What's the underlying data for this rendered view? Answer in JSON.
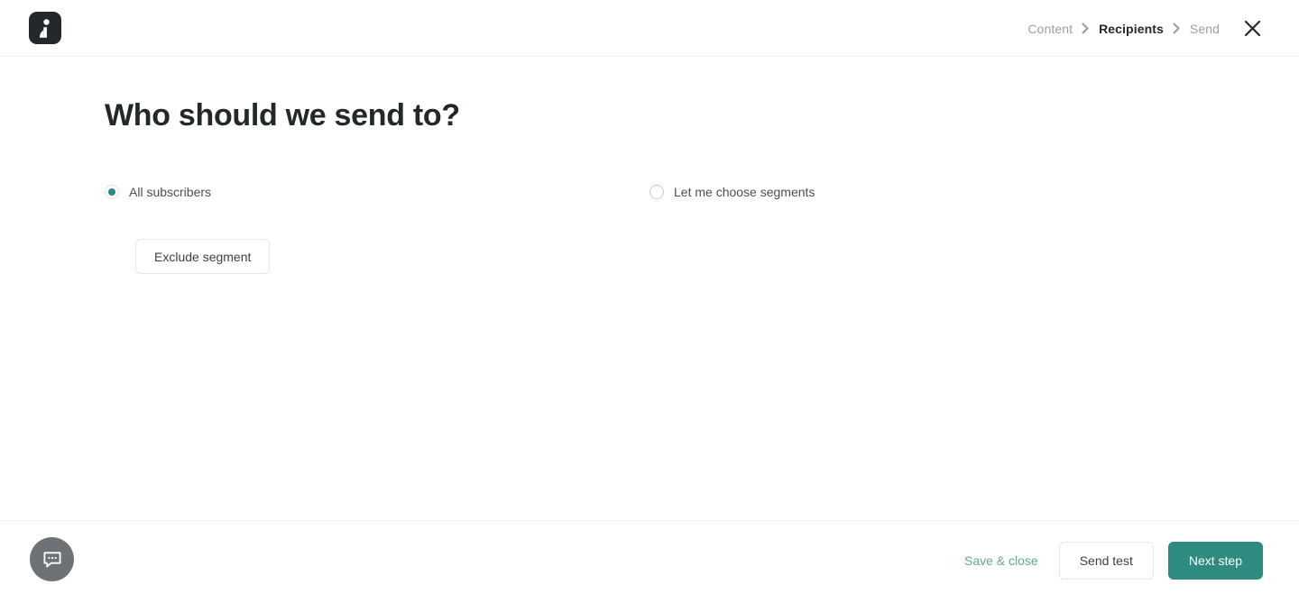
{
  "header": {
    "logo_name": "mailerlite-logo",
    "breadcrumb": [
      {
        "label": "Content",
        "state": "inactive"
      },
      {
        "label": "Recipients",
        "state": "active"
      },
      {
        "label": "Send",
        "state": "inactive"
      }
    ],
    "separator_icon": "chevron-right-icon",
    "close_icon": "close-icon"
  },
  "main": {
    "title": "Who should we send to?",
    "options": [
      {
        "label": "All subscribers",
        "selected": true
      },
      {
        "label": "Let me choose segments",
        "selected": false
      }
    ],
    "exclude_button": "Exclude segment"
  },
  "footer": {
    "chat_icon": "chat-bubble-icon",
    "save_close_label": "Save & close",
    "send_test_label": "Send test",
    "next_step_label": "Next step"
  },
  "colors": {
    "accent": "#2e8b80",
    "accent_light": "#64a59c",
    "logo_bg": "#23282b",
    "border": "#e4e7ea",
    "divider": "#eceef0",
    "text": "#3b3f42",
    "muted": "#9aa0a6",
    "chat_fab_bg": "#6e7276"
  }
}
